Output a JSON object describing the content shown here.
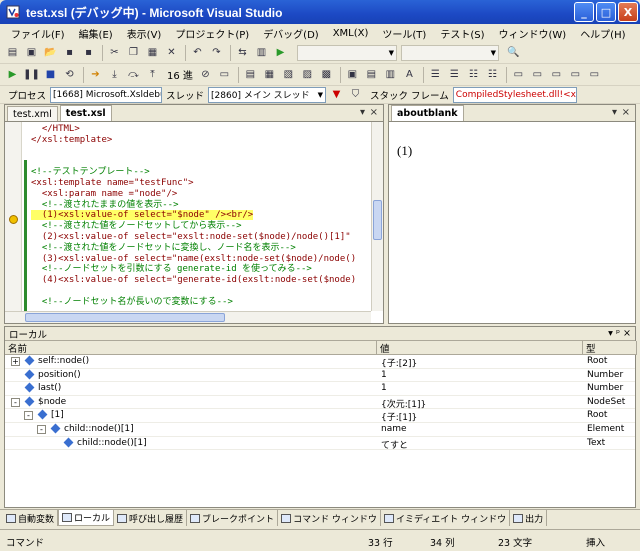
{
  "window": {
    "title": "test.xsl (デバッグ中) - Microsoft Visual Studio",
    "minimize": "_",
    "maximize": "□",
    "close": "X"
  },
  "menu": [
    "ファイル(F)",
    "編集(E)",
    "表示(V)",
    "プロジェクト(P)",
    "デバッグ(D)",
    "XML(X)",
    "ツール(T)",
    "テスト(S)",
    "ウィンドウ(W)",
    "ヘルプ(H)"
  ],
  "debugbar": {
    "hex_label": "16 進"
  },
  "processbar": {
    "process_label": "プロセス",
    "process_value": "[1668] Microsoft.Xsldebugg",
    "thread_label": "スレッド",
    "thread_value": "[2860] メイン スレッド",
    "stack_label": "スタック フレーム",
    "stack_value": "CompiledStylesheet.dll!<xsl:"
  },
  "editor": {
    "tabs": [
      "test.xml",
      "test.xsl"
    ],
    "lines": [
      {
        "t": "  </HTML>",
        "k": "el"
      },
      {
        "t": "</xsl:template>",
        "k": "el"
      },
      {
        "t": "",
        "k": "tx"
      },
      {
        "t": "",
        "k": "tx"
      },
      {
        "t": "<!--テストテンプレート-->",
        "k": "cm"
      },
      {
        "t": "<xsl:template name=\"testFunc\">",
        "k": "el"
      },
      {
        "t": "  <xsl:param name =\"node\"/>",
        "k": "el"
      },
      {
        "t": "  <!--渡されたままの値を表示-->",
        "k": "cm"
      },
      {
        "t": "  (1)<xsl:value-of select=\"$node\" /><br/>",
        "k": "hl"
      },
      {
        "t": "  <!--渡された値をノードセットしてから表示-->",
        "k": "cm"
      },
      {
        "t": "  (2)<xsl:value-of select=\"exslt:node-set($node)/node()[1]\"",
        "k": "el"
      },
      {
        "t": "  <!--渡された値をノードセットに変換し、ノード名を表示-->",
        "k": "cm"
      },
      {
        "t": "  (3)<xsl:value-of select=\"name(exslt:node-set($node)/node()",
        "k": "el"
      },
      {
        "t": "  <!--ノードセットを引数にする generate-id を使ってみる-->",
        "k": "cm"
      },
      {
        "t": "  (4)<xsl:value-of select=\"generate-id(exslt:node-set($node)",
        "k": "el"
      },
      {
        "t": "",
        "k": "tx"
      },
      {
        "t": "  <!--ノードセット名が長いので変数にする-->",
        "k": "cm"
      }
    ]
  },
  "browser": {
    "tab": "aboutblank",
    "content": "(1)"
  },
  "locals": {
    "title": "ローカル",
    "controls": "▾ ᵖ ×",
    "columns": [
      "名前",
      "値",
      "型"
    ],
    "rows": [
      {
        "name": "self::node()",
        "value": "{子:[2]}",
        "type": "Root",
        "level": 0,
        "exp": "+"
      },
      {
        "name": "position()",
        "value": "1",
        "type": "Number",
        "level": 0,
        "exp": ""
      },
      {
        "name": "last()",
        "value": "1",
        "type": "Number",
        "level": 0,
        "exp": ""
      },
      {
        "name": "$node",
        "value": "{次元:[1]}",
        "type": "NodeSet",
        "level": 0,
        "exp": "-"
      },
      {
        "name": "[1]",
        "value": "{子:[1]}",
        "type": "Root",
        "level": 1,
        "exp": "-"
      },
      {
        "name": "child::node()[1]",
        "value": "name",
        "type": "Element",
        "level": 2,
        "exp": "-"
      },
      {
        "name": "child::node()[1]",
        "value": "てすと",
        "type": "Text",
        "level": 3,
        "exp": ""
      }
    ]
  },
  "bottom_tabs": [
    "自動変数",
    "ローカル",
    "呼び出し履歴",
    "ブレークポイント",
    "コマンド ウィンドウ",
    "イミディエイト ウィンドウ",
    "出力"
  ],
  "status": {
    "mode": "コマンド",
    "line": "33 行",
    "col": "34 列",
    "char": "23 文字",
    "ins": "挿入"
  }
}
